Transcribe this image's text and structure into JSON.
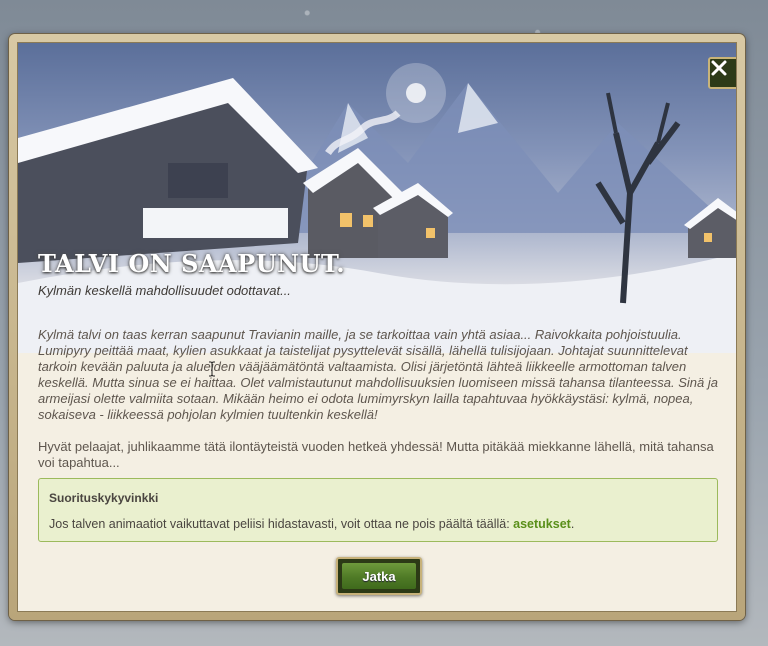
{
  "dialog": {
    "title": "TALVI ON SAAPUNUT.",
    "subtitle": "Kylmän keskellä mahdollisuudet odottavat...",
    "story": "Kylmä talvi on taas kerran saapunut Travianin maille, ja se tarkoittaa vain yhtä asiaa... Raivokkaita pohjoistuulia. Lumipyry peittää maat, kylien asukkaat ja taistelijat pysyttelevät sisällä, lähellä tulisijojaan. Johtajat suunnittelevat tarkoin kevään paluuta ja alueiden vääjäämätöntä valtaamista. Olisi järjetöntä lähteä liikkeelle armottoman talven keskellä. Mutta sinua se ei haittaa. Olet valmistautunut mahdollisuuksien luomiseen missä tahansa tilanteessa. Sinä ja armeijasi olette valmiita sotaan. Mikään heimo ei odota lumimyrskyn lailla tapahtuvaa hyökkäystäsi: kylmä, nopea, sokaiseva - liikkeessä pohjolan kylmien tuultenkin keskellä!",
    "greeting": "Hyvät pelaajat, juhlikaamme tätä ilontäyteistä vuoden hetkeä yhdessä! Mutta pitäkää miekkanne lähellä, mitä tahansa voi tapahtua...",
    "tip": {
      "title": "Suorituskykyvinkki",
      "text": "Jos talven animaatiot vaikuttavat peliisi hidastavasti, voit ottaa ne pois päältä täällä: ",
      "link": "asetukset",
      "end": "."
    },
    "continue_label": "Jatka",
    "close_icon": "close-icon"
  },
  "colors": {
    "button_green": "#4f7a26",
    "link_green": "#5a8f1a",
    "tip_bg": "#eaf0cf",
    "tip_border": "#9cba5c"
  }
}
